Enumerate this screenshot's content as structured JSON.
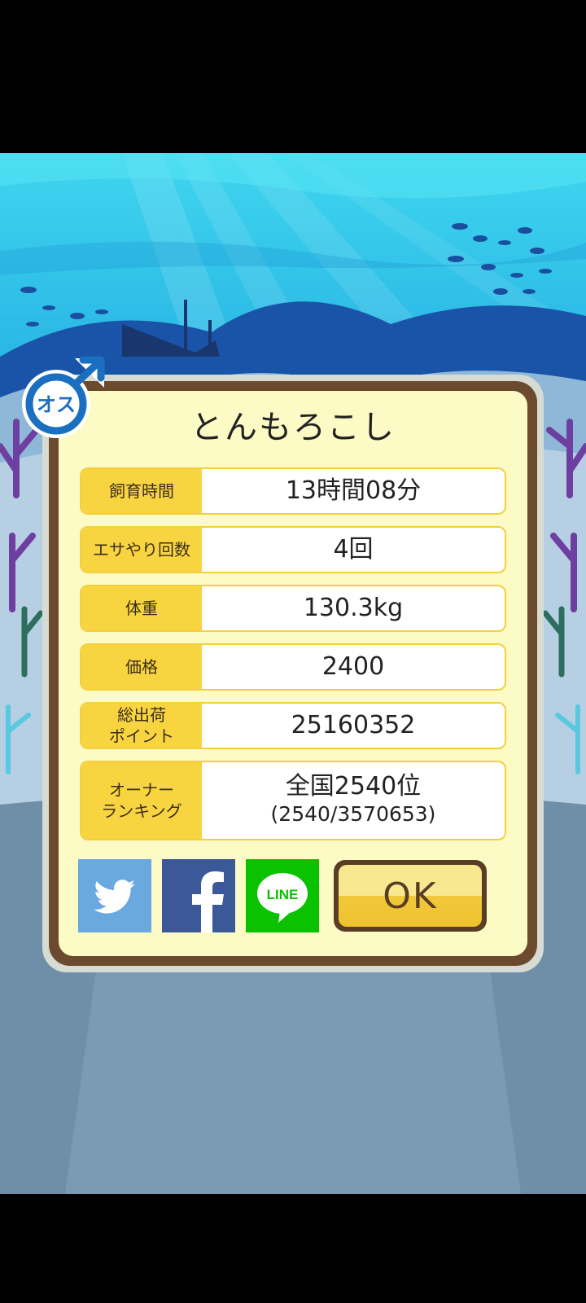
{
  "fish_name": "とんもろこし",
  "gender_badge": "オス",
  "stats": [
    {
      "label": "飼育時間",
      "value": "13時間08分"
    },
    {
      "label": "エサやり回数",
      "value": "4回"
    },
    {
      "label": "体重",
      "value": "130.3kg"
    },
    {
      "label": "価格",
      "value": "2400"
    },
    {
      "label": "総出荷\nポイント",
      "value": "25160352"
    },
    {
      "label": "オーナー\nランキング",
      "value": "全国2540位",
      "sub": "(2540/3570653)"
    }
  ],
  "share": {
    "line_label": "LINE"
  },
  "ok_label": "OK",
  "colors": {
    "twitter": "#6aa8e0",
    "facebook": "#3b5998",
    "line": "#0bc200",
    "panel_bg": "#fdfbc5",
    "label_bg": "#f8d441",
    "frame": "#6b4a2e"
  }
}
